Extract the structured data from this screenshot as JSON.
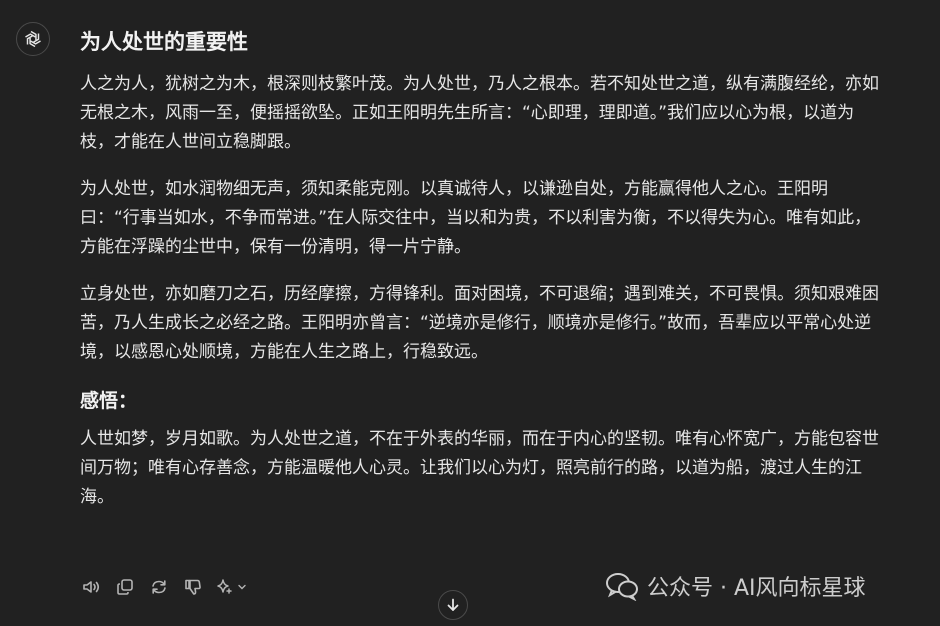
{
  "message": {
    "title": "为人处世的重要性",
    "paragraphs": [
      "人之为人，犹树之为木，根深则枝繁叶茂。为人处世，乃人之根本。若不知处世之道，纵有满腹经纶，亦如无根之木，风雨一至，便摇摇欲坠。正如王阳明先生所言：“心即理，理即道。”我们应以心为根，以道为枝，才能在人世间立稳脚跟。",
      "为人处世，如水润物细无声，须知柔能克刚。以真诚待人，以谦逊自处，方能赢得他人之心。王阳明曰：“行事当如水，不争而常进。”在人际交往中，当以和为贵，不以利害为衡，不以得失为心。唯有如此，方能在浮躁的尘世中，保有一份清明，得一片宁静。",
      "立身处世，亦如磨刀之石，历经摩擦，方得锋利。面对困境，不可退缩；遇到难关，不可畏惧。须知艰难困苦，乃人生成长之必经之路。王阳明亦曾言：“逆境亦是修行，顺境亦是修行。”故而，吾辈应以平常心处逆境，以感恩心处顺境，方能在人生之路上，行稳致远。"
    ],
    "subheading": "感悟：",
    "closing": "人世如梦，岁月如歌。为人处世之道，不在于外表的华丽，而在于内心的坚韧。唯有心怀宽广，方能包容世间万物；唯有心存善念，方能温暖他人心灵。让我们以心为灯，照亮前行的路，以道为船，渡过人生的江海。"
  },
  "actions": [
    {
      "name": "read-aloud",
      "icon": "speaker-icon"
    },
    {
      "name": "copy",
      "icon": "copy-icon"
    },
    {
      "name": "regenerate",
      "icon": "refresh-icon"
    },
    {
      "name": "bad-response",
      "icon": "thumbs-down-icon"
    },
    {
      "name": "model-switch",
      "icon": "sparkle-icon"
    }
  ],
  "watermark": {
    "text": "公众号 · AI风向标星球"
  },
  "colors": {
    "background": "#212121",
    "text": "#ececec",
    "icon": "#b4b4b4"
  }
}
